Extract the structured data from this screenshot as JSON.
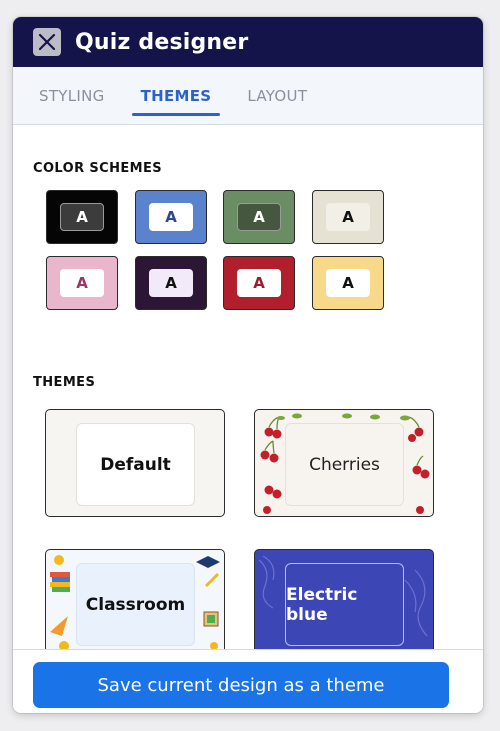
{
  "window": {
    "title": "Quiz designer",
    "close_icon": "close-icon"
  },
  "tabs": [
    {
      "label": "STYLING",
      "active": false
    },
    {
      "label": "THEMES",
      "active": true
    },
    {
      "label": "LAYOUT",
      "active": false
    }
  ],
  "color_schemes": {
    "heading": "COLOR SCHEMES",
    "items": [
      {
        "letter": "A",
        "bg": "#050505",
        "chip_bg": "#3c3c3c",
        "chip_fg": "#ffffff"
      },
      {
        "letter": "A",
        "bg": "#5b82cc",
        "chip_bg": "#ffffff",
        "chip_fg": "#2a4a8a"
      },
      {
        "letter": "A",
        "bg": "#6b8d64",
        "chip_bg": "#46573f",
        "chip_fg": "#ffffff"
      },
      {
        "letter": "A",
        "bg": "#e5e1d3",
        "chip_bg": "#f1efe6",
        "chip_fg": "#111111"
      },
      {
        "letter": "A",
        "bg": "#e9b6cc",
        "chip_bg": "#ffffff",
        "chip_fg": "#9c3564"
      },
      {
        "letter": "A",
        "bg": "#2c1636",
        "chip_bg": "#f2eaf8",
        "chip_fg": "#111111"
      },
      {
        "letter": "A",
        "bg": "#b21f2c",
        "chip_bg": "#ffffff",
        "chip_fg": "#9a1d27"
      },
      {
        "letter": "A",
        "bg": "#f8d98a",
        "chip_bg": "#ffffff",
        "chip_fg": "#111111"
      }
    ]
  },
  "themes": {
    "heading": "THEMES",
    "items": [
      {
        "label": "Default",
        "bg": "#f6f5f2",
        "inner_bg": "#ffffff",
        "fg": "#111111"
      },
      {
        "label": "Cherries",
        "bg": "#f7f4ef",
        "inner_bg": "#f7f4ef",
        "fg": "#222222"
      },
      {
        "label": "Classroom",
        "bg": "#f4f8fd",
        "inner_bg": "#e8f1fc",
        "fg": "#111111"
      },
      {
        "label": "Electric blue",
        "bg": "#3d46b5",
        "inner_bg": "#3d46b5",
        "fg": "#ffffff"
      }
    ]
  },
  "footer": {
    "save_label": "Save current design as a theme"
  },
  "colors": {
    "titlebar": "#14144a",
    "accent": "#2b63c9",
    "button": "#1a74e8"
  }
}
